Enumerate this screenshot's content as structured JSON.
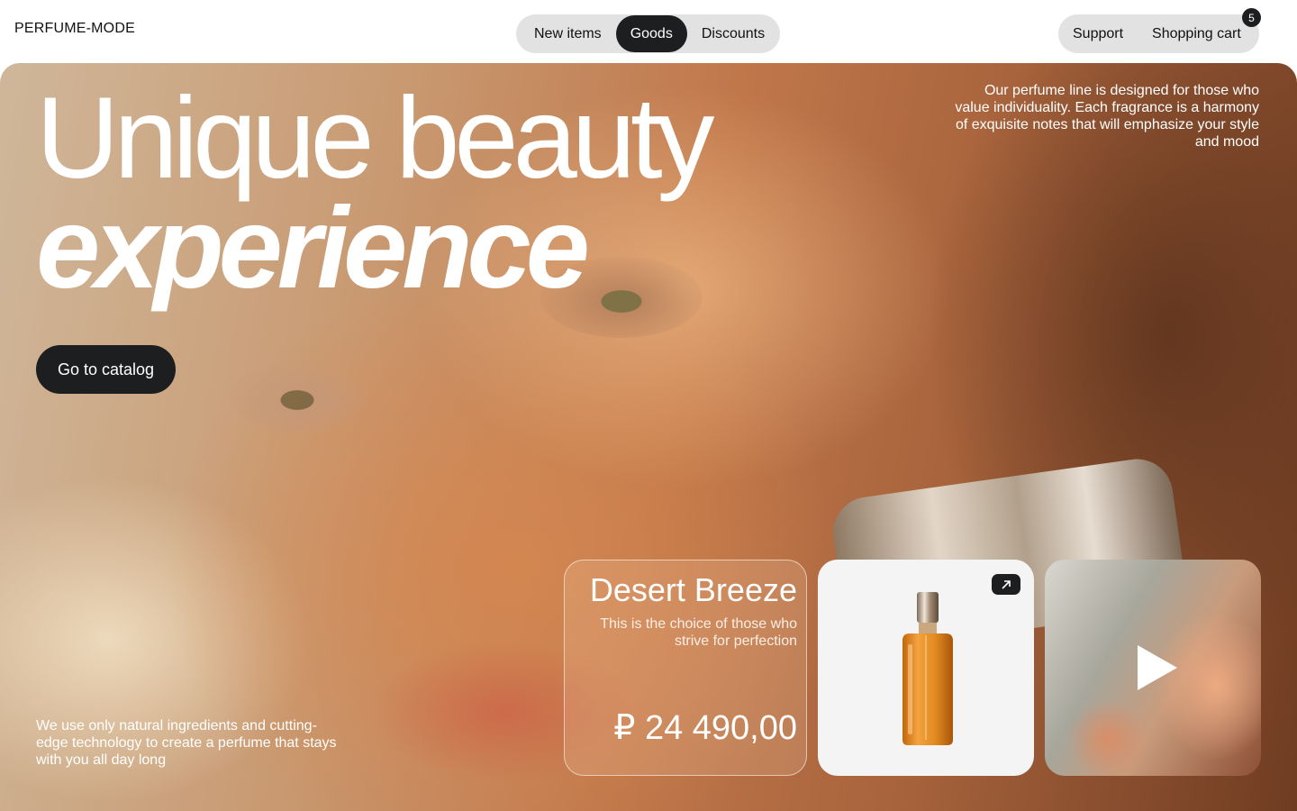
{
  "header": {
    "logo": "PERFUME-MODE",
    "nav": [
      {
        "label": "New items",
        "active": false
      },
      {
        "label": "Goods",
        "active": true
      },
      {
        "label": "Discounts",
        "active": false
      }
    ],
    "support_label": "Support",
    "cart_label": "Shopping cart",
    "cart_count": "5"
  },
  "hero": {
    "headline_line1": "Unique beauty",
    "headline_line2": "experience",
    "intro": "Our perfume line is designed for those who value individuality. Each fragrance is a harmony of exquisite notes that will emphasize your style and mood",
    "cta_label": "Go to catalog",
    "bottom_note": "We use only natural ingredients and cutting-edge technology to create a perfume that stays with you all day long"
  },
  "product": {
    "name": "Desert Breeze",
    "description": "This is the choice of those who strive for perfection",
    "price": "₽ 24 490,00"
  },
  "icons": {
    "cart_badge": "badge",
    "product_link": "arrow-up-right-icon",
    "video": "play-icon"
  },
  "colors": {
    "accent_dark": "#1d1e20",
    "pill_bg": "#e2e2e2",
    "hero_text": "#ffffff"
  }
}
